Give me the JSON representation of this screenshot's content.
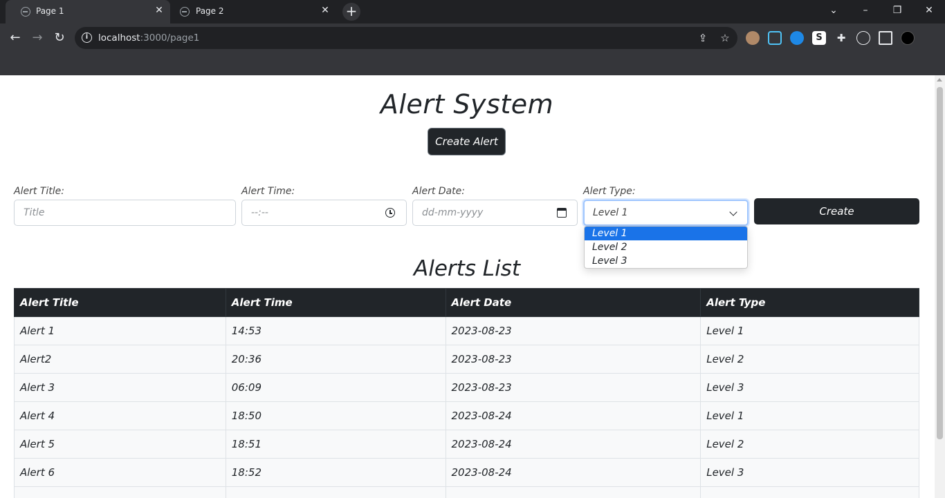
{
  "browser": {
    "tabs": [
      {
        "title": "Page 1",
        "active": true
      },
      {
        "title": "Page 2",
        "active": false
      }
    ],
    "url_host": "localhost",
    "url_path": ":3000/page1"
  },
  "page": {
    "title": "Alert System",
    "create_alert_label": "Create Alert",
    "form": {
      "title_label": "Alert Title:",
      "title_placeholder": "Title",
      "time_label": "Alert Time:",
      "time_placeholder": "--:--",
      "date_label": "Alert Date:",
      "date_placeholder": "dd-mm-yyyy",
      "type_label": "Alert Type:",
      "type_selected": "Level 1",
      "type_options": [
        "Level 1",
        "Level 2",
        "Level 3"
      ],
      "create_label": "Create"
    },
    "list_title": "Alerts List",
    "table": {
      "headers": [
        "Alert Title",
        "Alert Time",
        "Alert Date",
        "Alert Type"
      ],
      "rows": [
        [
          "Alert 1",
          "14:53",
          "2023-08-23",
          "Level 1"
        ],
        [
          "Alert2",
          "20:36",
          "2023-08-23",
          "Level 2"
        ],
        [
          "Alert 3",
          "06:09",
          "2023-08-23",
          "Level 3"
        ],
        [
          "Alert 4",
          "18:50",
          "2023-08-24",
          "Level 1"
        ],
        [
          "Alert 5",
          "18:51",
          "2023-08-24",
          "Level 2"
        ],
        [
          "Alert 6",
          "18:52",
          "2023-08-24",
          "Level 3"
        ],
        [
          "",
          "",
          "",
          ""
        ]
      ]
    }
  },
  "colors": {
    "dark": "#212529",
    "selected_option": "#1a73e8"
  }
}
